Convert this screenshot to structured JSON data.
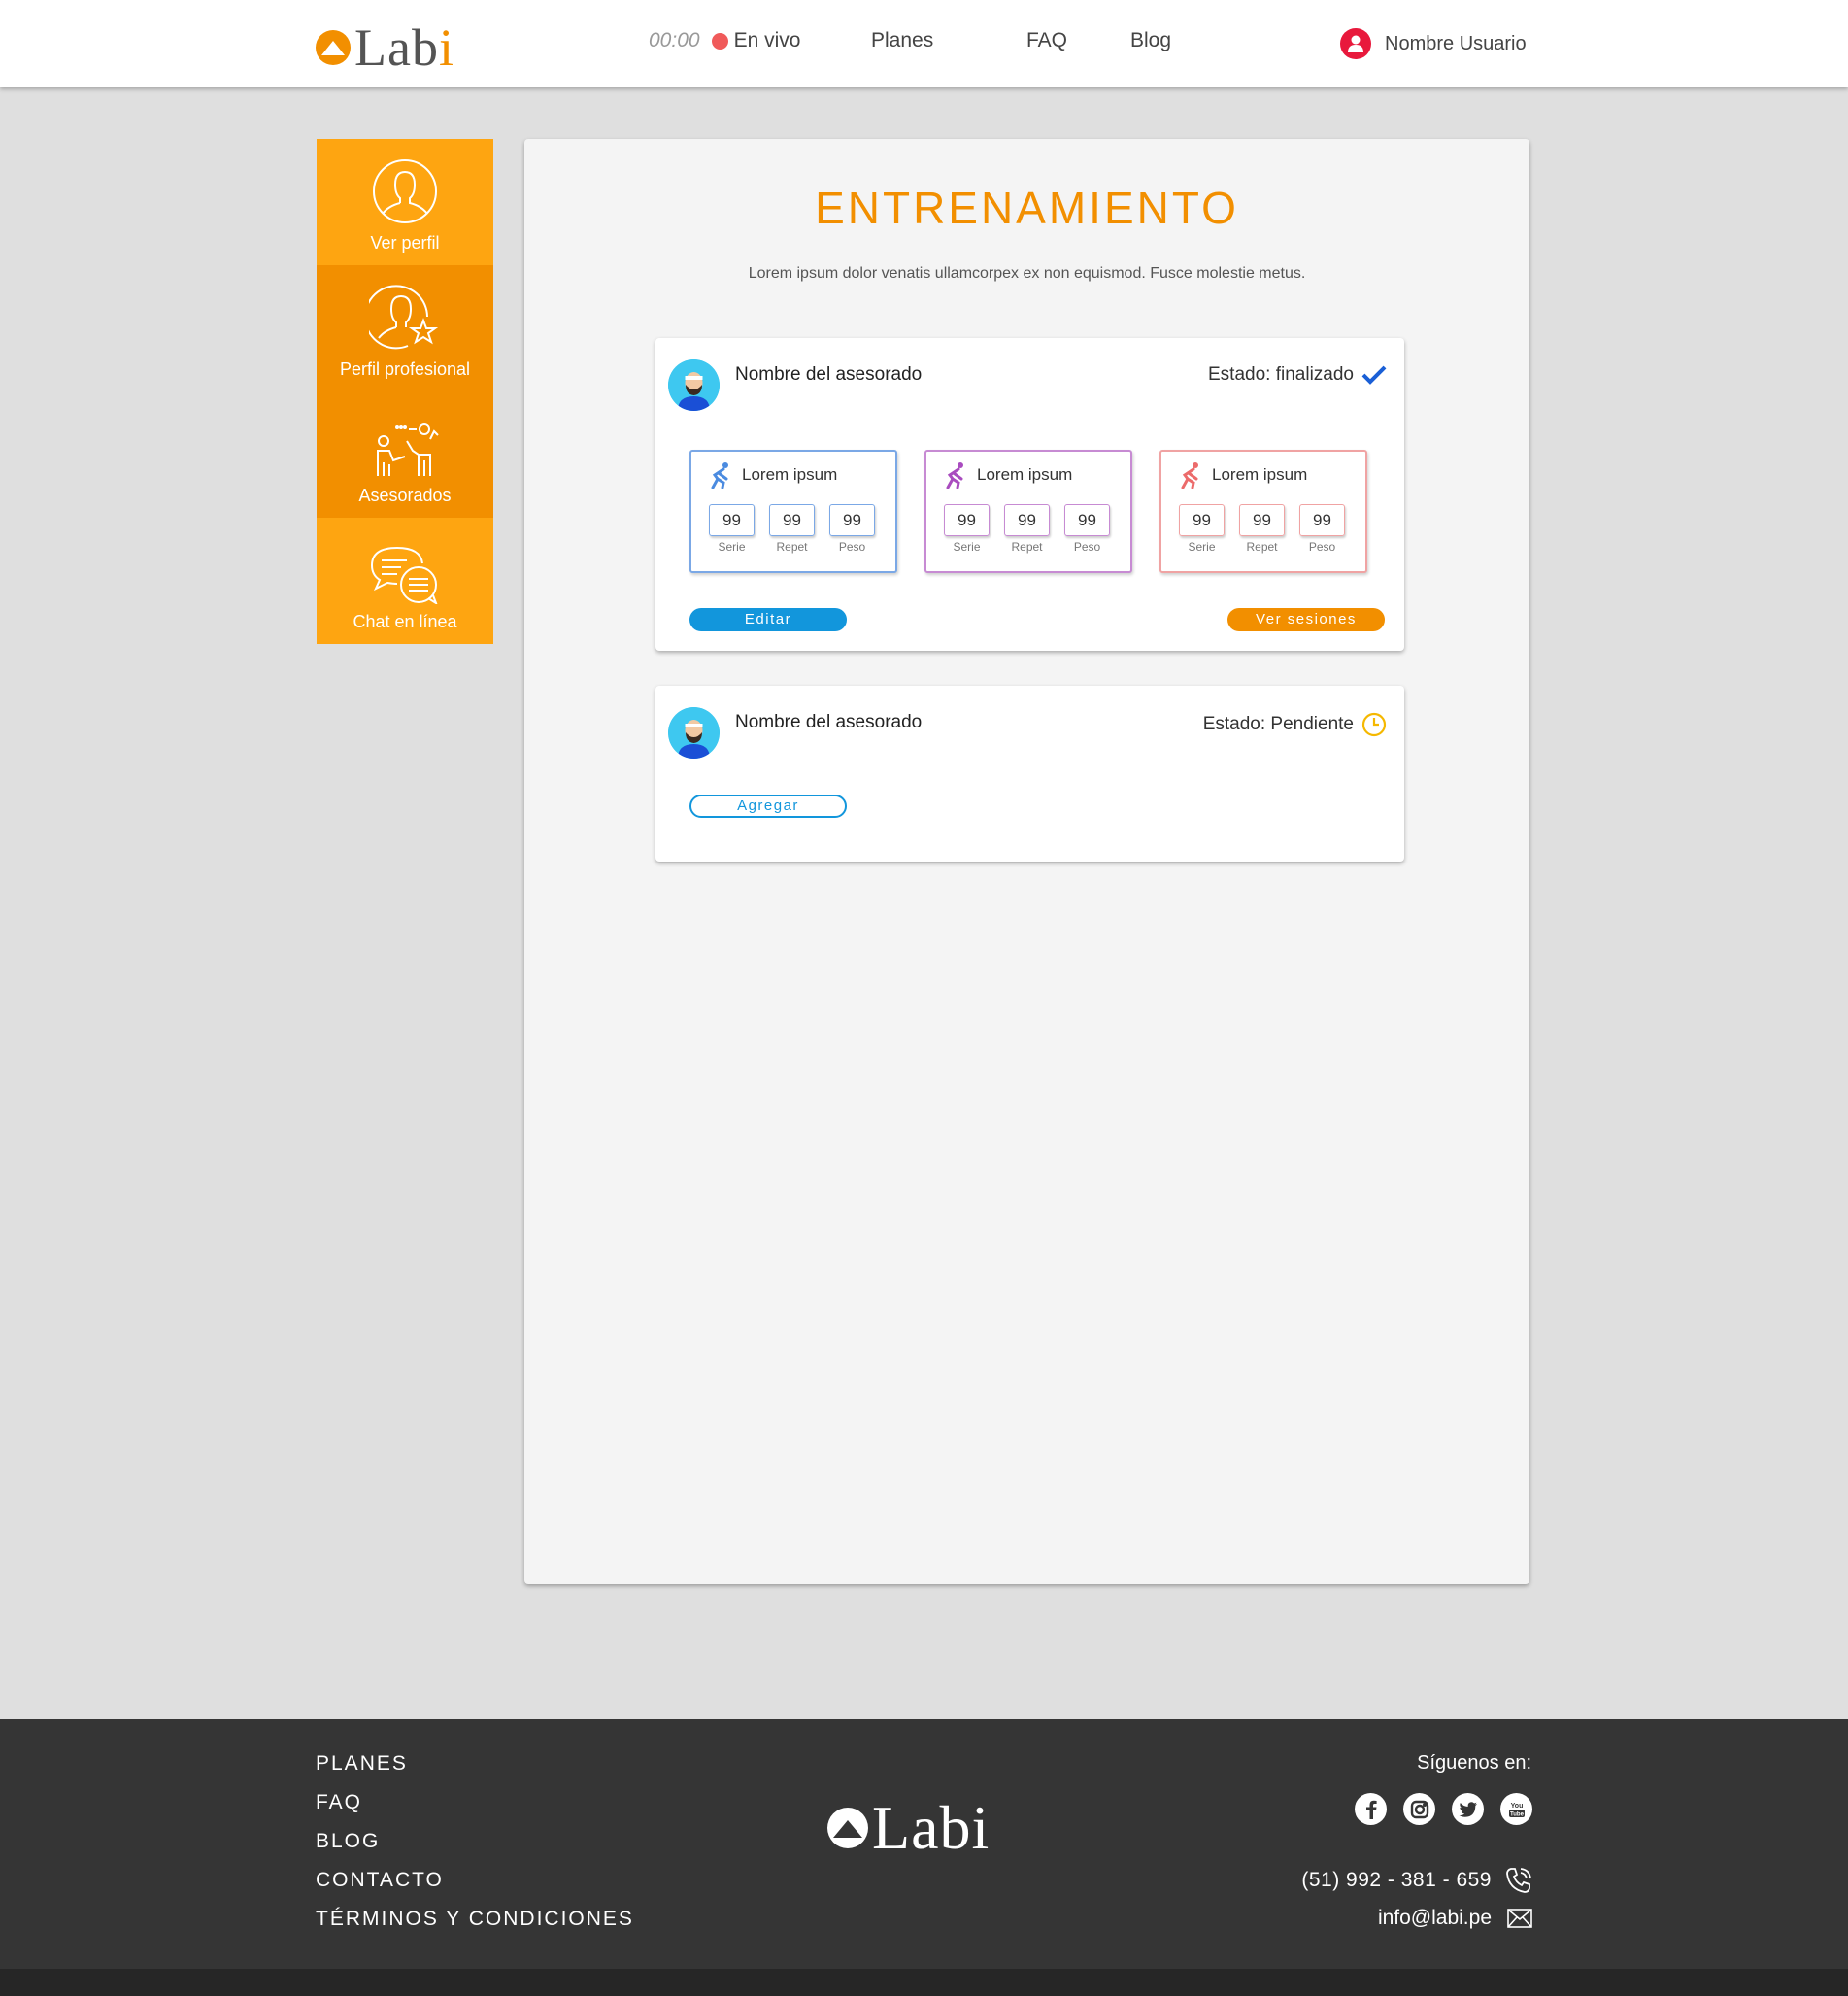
{
  "header": {
    "logo_main": "Lab",
    "logo_accent": "i",
    "timer": "00:00",
    "live_label": "En vivo",
    "nav": {
      "plans": "Planes",
      "faq": "FAQ",
      "blog": "Blog"
    },
    "user_name": "Nombre Usuario"
  },
  "sidebar": {
    "items": [
      {
        "label": "Ver perfil",
        "icon": "user-icon"
      },
      {
        "label": "Perfil profesional",
        "icon": "user-star-icon"
      },
      {
        "label": "Asesorados",
        "icon": "coaching-icon"
      },
      {
        "label": "Chat en línea",
        "icon": "chat-icon"
      }
    ]
  },
  "main": {
    "title": "ENTRENAMIENTO",
    "description": "Lorem ipsum dolor venatis ullamcorpex ex non equismod. Fusce molestie metus."
  },
  "cards": [
    {
      "name": "Nombre del asesorado",
      "status": "Estado: finalizado",
      "exercises": [
        {
          "title": "Lorem ipsum",
          "serie": "99",
          "repet": "99",
          "peso": "99"
        },
        {
          "title": "Lorem ipsum",
          "serie": "99",
          "repet": "99",
          "peso": "99"
        },
        {
          "title": "Lorem ipsum",
          "serie": "99",
          "repet": "99",
          "peso": "99"
        }
      ],
      "stat_labels": {
        "serie": "Serie",
        "repet": "Repet",
        "peso": "Peso"
      },
      "edit_label": "Editar",
      "sessions_label": "Ver sesiones"
    },
    {
      "name": "Nombre del asesorado",
      "status": "Estado: Pendiente",
      "add_label": "Agregar"
    }
  ],
  "colors": {
    "brand_orange": "#f28f00",
    "sidebar_light": "#fea511",
    "button_blue": "#1296dc",
    "live_red": "#f05a5a",
    "footer_bg": "#353535"
  },
  "footer": {
    "links": [
      "PLANES",
      "FAQ",
      "BLOG",
      "CONTACTO",
      "TÉRMINOS Y CONDICIONES"
    ],
    "logo": "Labi",
    "follow_label": "Síguenos en:",
    "phone": "(51) 992 - 381 - 659",
    "email": "info@labi.pe",
    "socials": [
      "facebook-icon",
      "instagram-icon",
      "twitter-icon",
      "youtube-icon"
    ]
  }
}
